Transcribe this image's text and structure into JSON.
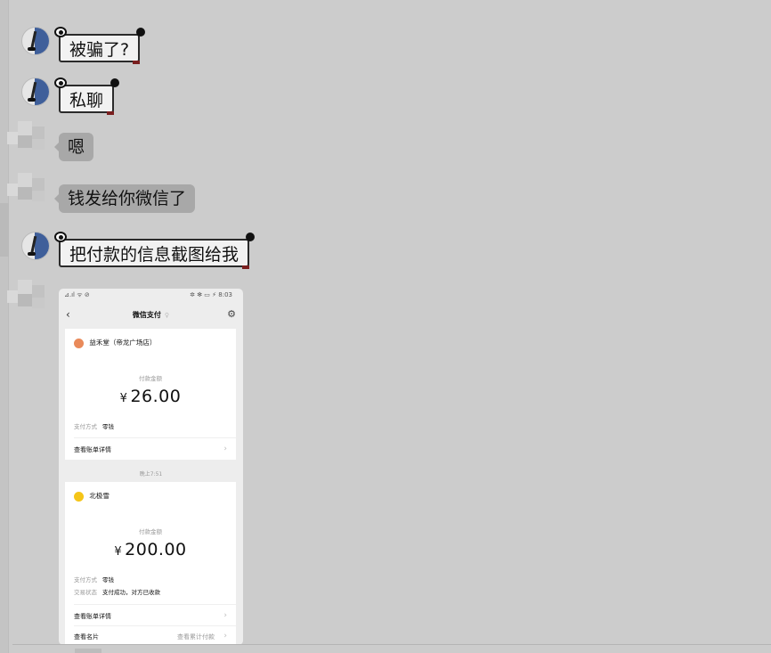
{
  "messages": [
    {
      "text": "被骗了?"
    },
    {
      "text": "私聊"
    },
    {
      "text": "嗯"
    },
    {
      "text": "钱发给你微信了"
    },
    {
      "text": "把付款的信息截图给我"
    }
  ],
  "screenshot": {
    "status_left": "⊿.ıl ᯤ ⊘",
    "status_right": "✲ ✻ ▭ ⚡ 8:03",
    "header_title": "微信支付",
    "back_glyph": "‹",
    "gear_glyph": "⚙",
    "pin_glyph": "♀",
    "timestamp": "晚上7:51",
    "payments": [
      {
        "merchant": "益禾堂（帝龙广场店）",
        "amount_label": "付款金额",
        "currency": "¥",
        "amount": "26.00",
        "method_key": "支付方式",
        "method_value": "零钱",
        "bill_link": "查看账单详情"
      },
      {
        "merchant": "北极雪",
        "amount_label": "付款金额",
        "currency": "¥",
        "amount": "200.00",
        "method_key": "支付方式",
        "method_value": "零钱",
        "status_key": "交易状态",
        "status_value": "支付成功，对方已收款",
        "bill_link": "查看账单详情",
        "card_link": "查看名片",
        "card_link_extra": "查看累计付款"
      }
    ]
  }
}
